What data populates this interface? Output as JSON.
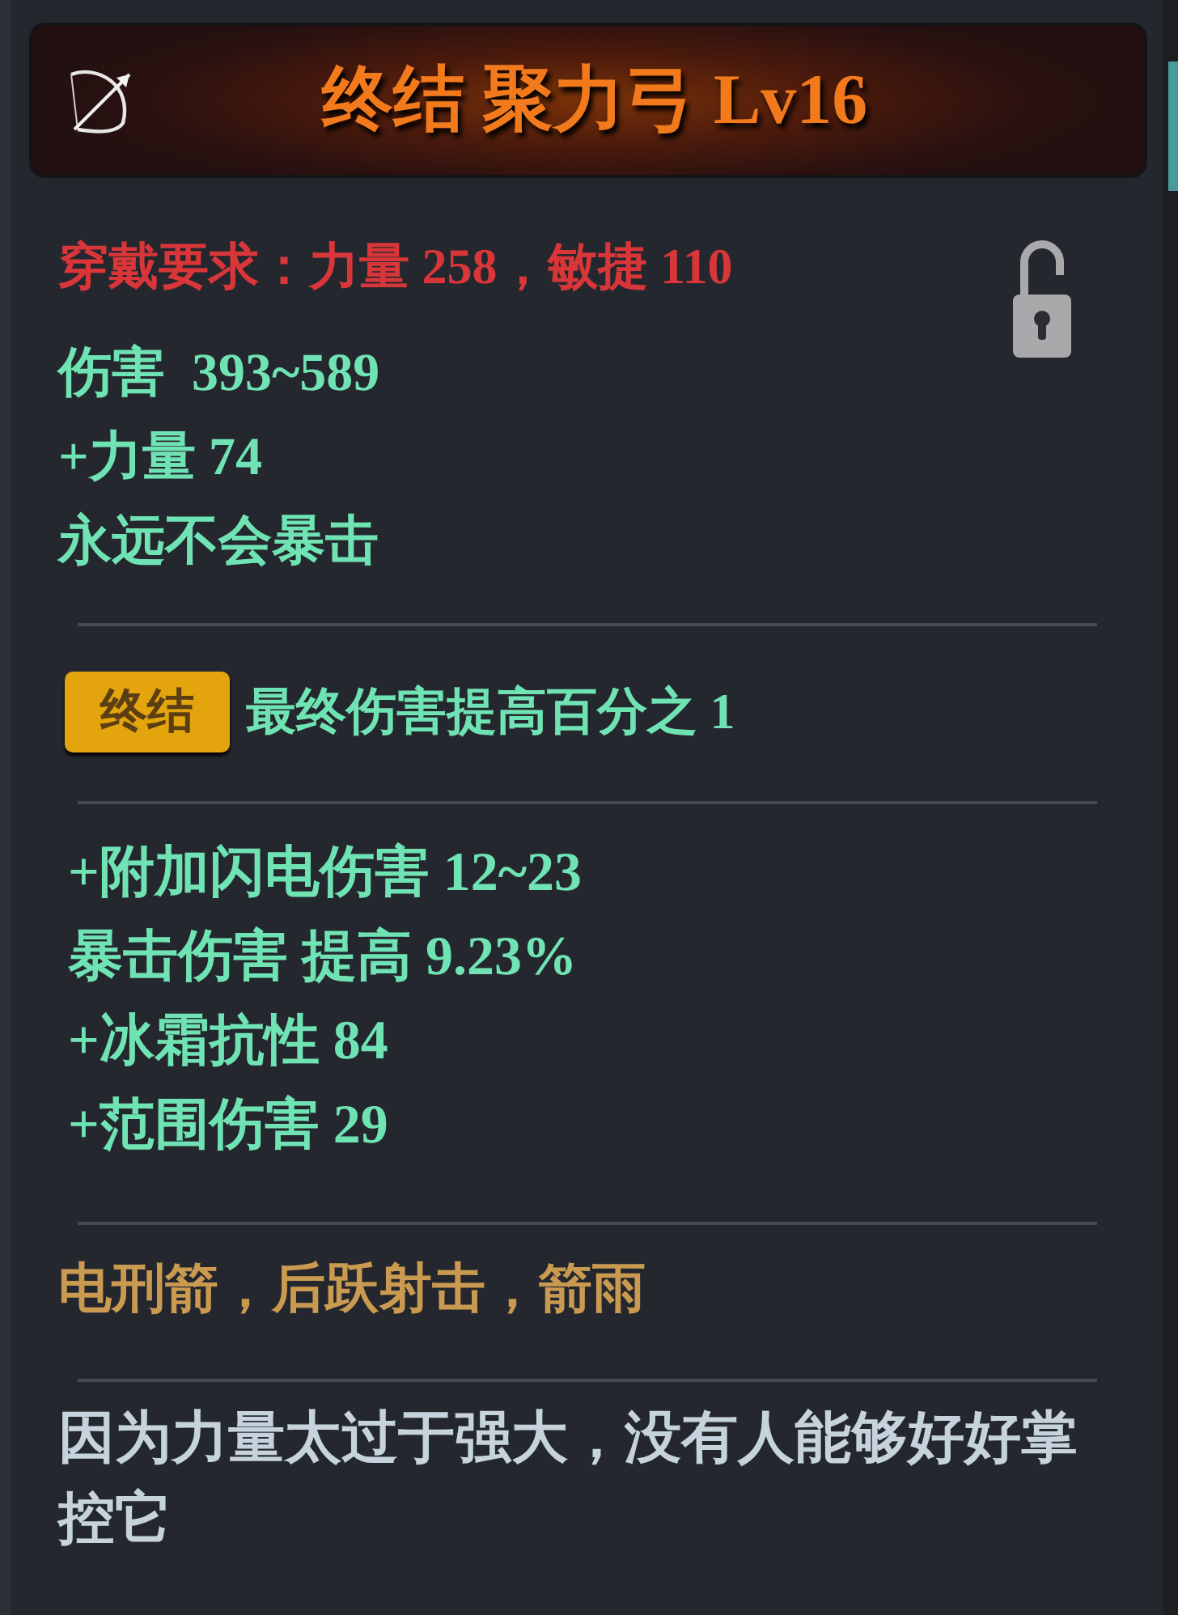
{
  "header": {
    "title": "终结 聚力弓 Lv16"
  },
  "requirement": "穿戴要求：力量 258，敏捷 110",
  "lock": {
    "locked": false
  },
  "base_stats": [
    "伤害  393~589",
    "+力量 74",
    "永远不会暴击"
  ],
  "set_bonus": {
    "badge": "终结",
    "text": "最终伤害提高百分之 1"
  },
  "affixes": [
    "+附加闪电伤害 12~23",
    "暴击伤害 提高 9.23%",
    "+冰霜抗性 84",
    "+范围伤害 29"
  ],
  "skills": "电刑箭，后跃射击，箭雨",
  "description": "因为力量太过于强大，没有人能够好好掌控它"
}
